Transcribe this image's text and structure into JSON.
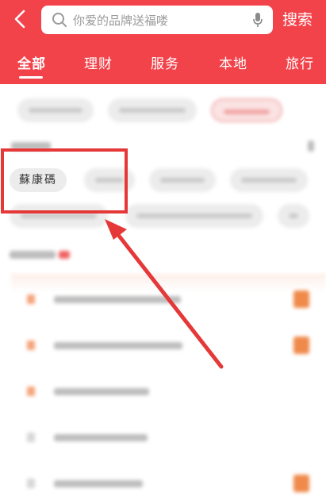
{
  "header": {
    "search_placeholder": "你爱的品牌送福喽",
    "search_button": "搜索",
    "tabs": [
      {
        "label": "全部"
      },
      {
        "label": "理财"
      },
      {
        "label": "服务"
      },
      {
        "label": "本地"
      },
      {
        "label": "旅行"
      }
    ]
  },
  "content": {
    "highlighted_chip": "蘇康碼"
  },
  "colors": {
    "brand_red": "#f2434b",
    "annotation_red": "#e53838",
    "rank_tag": "#f08a4b"
  },
  "icons": [
    "back-icon",
    "search-icon",
    "microphone-icon",
    "arrow-annotation"
  ]
}
